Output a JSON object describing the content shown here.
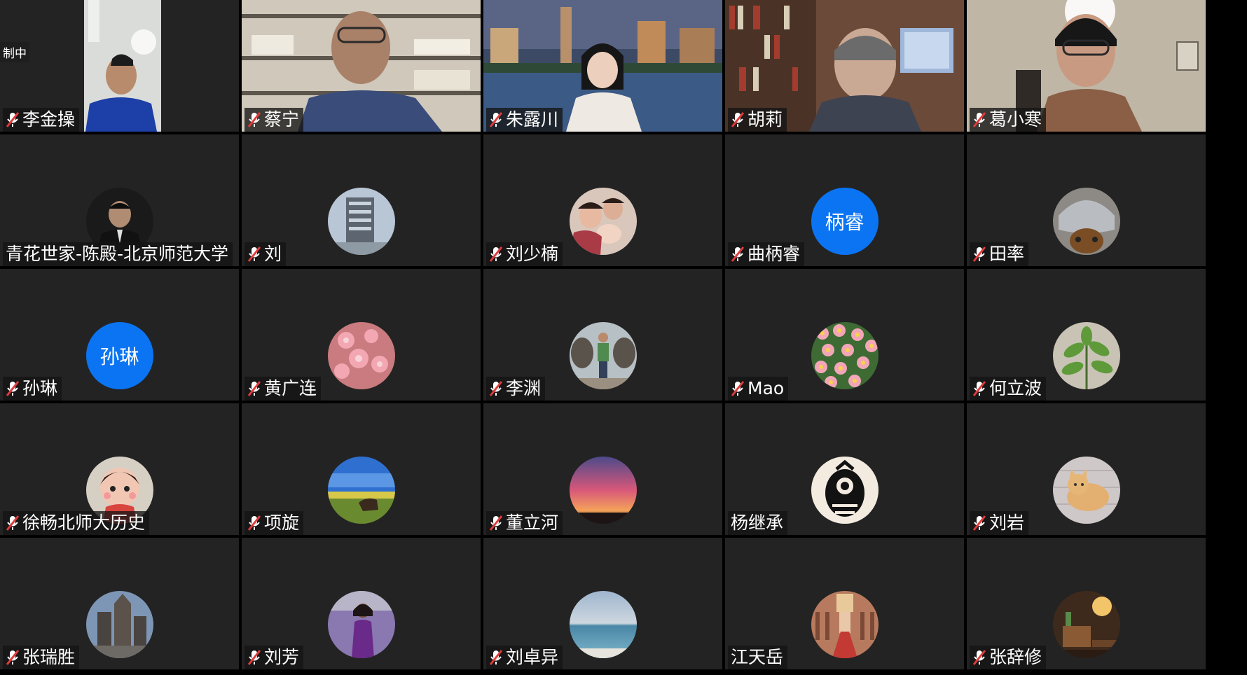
{
  "recording_label": "制中",
  "participants": [
    {
      "name": "李金操",
      "muted": true,
      "kind": "video",
      "scene": "person-white-room"
    },
    {
      "name": "蔡宁",
      "muted": true,
      "kind": "video",
      "scene": "person-bookshelf"
    },
    {
      "name": "朱露川",
      "muted": true,
      "kind": "video",
      "scene": "person-city-night"
    },
    {
      "name": "胡莉",
      "muted": true,
      "kind": "video",
      "scene": "person-library"
    },
    {
      "name": "葛小寒",
      "muted": true,
      "kind": "video",
      "scene": "person-room"
    },
    {
      "name": "青花世家-陈殿-北京师范大学",
      "muted": false,
      "kind": "photo",
      "scene": "portrait-suit"
    },
    {
      "name": "刘",
      "muted": true,
      "kind": "photo",
      "scene": "building"
    },
    {
      "name": "刘少楠",
      "muted": true,
      "kind": "photo",
      "scene": "family-baby"
    },
    {
      "name": "曲柄睿",
      "muted": true,
      "kind": "text",
      "initials": "柄睿"
    },
    {
      "name": "田率",
      "muted": true,
      "kind": "photo",
      "scene": "sculpture"
    },
    {
      "name": "孙琳",
      "muted": true,
      "kind": "text",
      "initials": "孙琳"
    },
    {
      "name": "黄广连",
      "muted": true,
      "kind": "photo",
      "scene": "pink-blossoms"
    },
    {
      "name": "李渊",
      "muted": true,
      "kind": "photo",
      "scene": "person-statues"
    },
    {
      "name": "Mao",
      "muted": true,
      "kind": "photo",
      "scene": "flowers-daisies"
    },
    {
      "name": "何立波",
      "muted": true,
      "kind": "photo",
      "scene": "green-plant"
    },
    {
      "name": "徐畅北师大历史",
      "muted": true,
      "kind": "photo",
      "scene": "cartoon-child"
    },
    {
      "name": "项旋",
      "muted": true,
      "kind": "photo",
      "scene": "grassland-horse"
    },
    {
      "name": "董立河",
      "muted": true,
      "kind": "photo",
      "scene": "sunset-sky"
    },
    {
      "name": "杨继承",
      "muted": false,
      "kind": "photo",
      "scene": "owl-logo"
    },
    {
      "name": "刘岩",
      "muted": true,
      "kind": "photo",
      "scene": "cat"
    },
    {
      "name": "张瑞胜",
      "muted": true,
      "kind": "photo",
      "scene": "cathedral"
    },
    {
      "name": "刘芳",
      "muted": true,
      "kind": "photo",
      "scene": "lavender-person"
    },
    {
      "name": "刘卓异",
      "muted": true,
      "kind": "photo",
      "scene": "sea-horizon"
    },
    {
      "name": "江天岳",
      "muted": false,
      "kind": "photo",
      "scene": "palace-gate"
    },
    {
      "name": "张辞修",
      "muted": true,
      "kind": "photo",
      "scene": "interior-lamp"
    }
  ],
  "colors": {
    "tile_bg": "#232323",
    "page_bg": "#000000",
    "avatar_blue": "#0b74f2",
    "label_bg": "#141414"
  }
}
